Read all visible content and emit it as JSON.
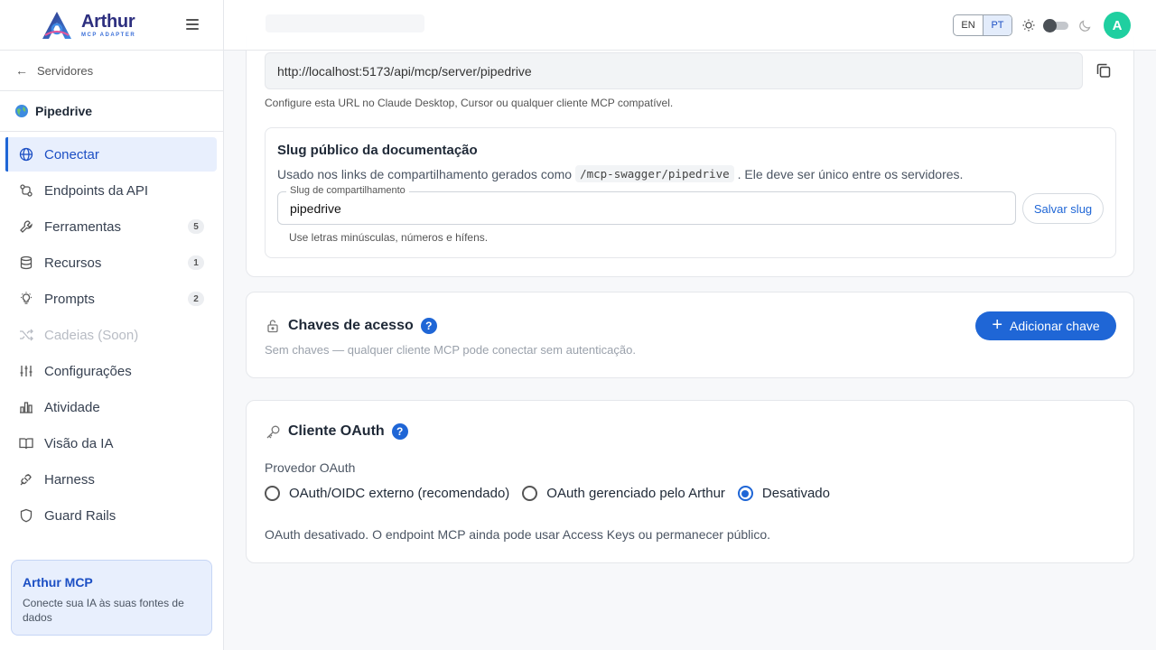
{
  "brand": {
    "name": "Arthur",
    "subtitle": "MCP ADAPTER"
  },
  "sidebar": {
    "back_label": "Servidores",
    "server_name": "Pipedrive",
    "items": [
      {
        "label": "Conectar",
        "icon": "globe-icon",
        "active": true
      },
      {
        "label": "Endpoints da API",
        "icon": "endpoints-icon"
      },
      {
        "label": "Ferramentas",
        "icon": "wrench-icon",
        "badge": "5"
      },
      {
        "label": "Recursos",
        "icon": "database-icon",
        "badge": "1"
      },
      {
        "label": "Prompts",
        "icon": "lightbulb-icon",
        "badge": "2"
      },
      {
        "label": "Cadeias (Soon)",
        "icon": "shuffle-icon",
        "disabled": true
      },
      {
        "label": "Configurações",
        "icon": "sliders-icon"
      },
      {
        "label": "Atividade",
        "icon": "bar-chart-icon"
      },
      {
        "label": "Visão da IA",
        "icon": "book-icon"
      },
      {
        "label": "Harness",
        "icon": "plug-icon"
      },
      {
        "label": "Guard Rails",
        "icon": "shield-icon"
      }
    ],
    "promo": {
      "title": "Arthur MCP",
      "description": "Conecte sua IA às suas fontes de dados"
    }
  },
  "topbar": {
    "lang_en": "EN",
    "lang_pt": "PT",
    "avatar_initial": "A",
    "accent": "#1f66d6",
    "avatar_color": "#1fcfa0"
  },
  "connect": {
    "url": "http://localhost:5173/api/mcp/server/pipedrive",
    "url_hint": "Configure esta URL no Claude Desktop, Cursor ou qualquer cliente MCP compatível.",
    "slug": {
      "title": "Slug público da documentação",
      "desc_before": "Usado nos links de compartilhamento gerados como",
      "desc_code": "/mcp-swagger/pipedrive",
      "desc_after": ". Ele deve ser único entre os servidores.",
      "field_label": "Slug de compartilhamento",
      "value": "pipedrive",
      "save_label": "Salvar slug",
      "help": "Use letras minúsculas, números e hífens."
    }
  },
  "access_keys": {
    "title": "Chaves de acesso",
    "help_icon": "?",
    "empty": "Sem chaves — qualquer cliente MCP pode conectar sem autenticação.",
    "add_label": "Adicionar chave"
  },
  "oauth": {
    "title": "Cliente OAuth",
    "help_icon": "?",
    "provider_label": "Provedor OAuth",
    "options": [
      {
        "label": "OAuth/OIDC externo (recomendado)",
        "selected": false
      },
      {
        "label": "OAuth gerenciado pelo Arthur",
        "selected": false
      },
      {
        "label": "Desativado",
        "selected": true
      }
    ],
    "note": "OAuth desativado. O endpoint MCP ainda pode usar Access Keys ou permanecer público."
  }
}
